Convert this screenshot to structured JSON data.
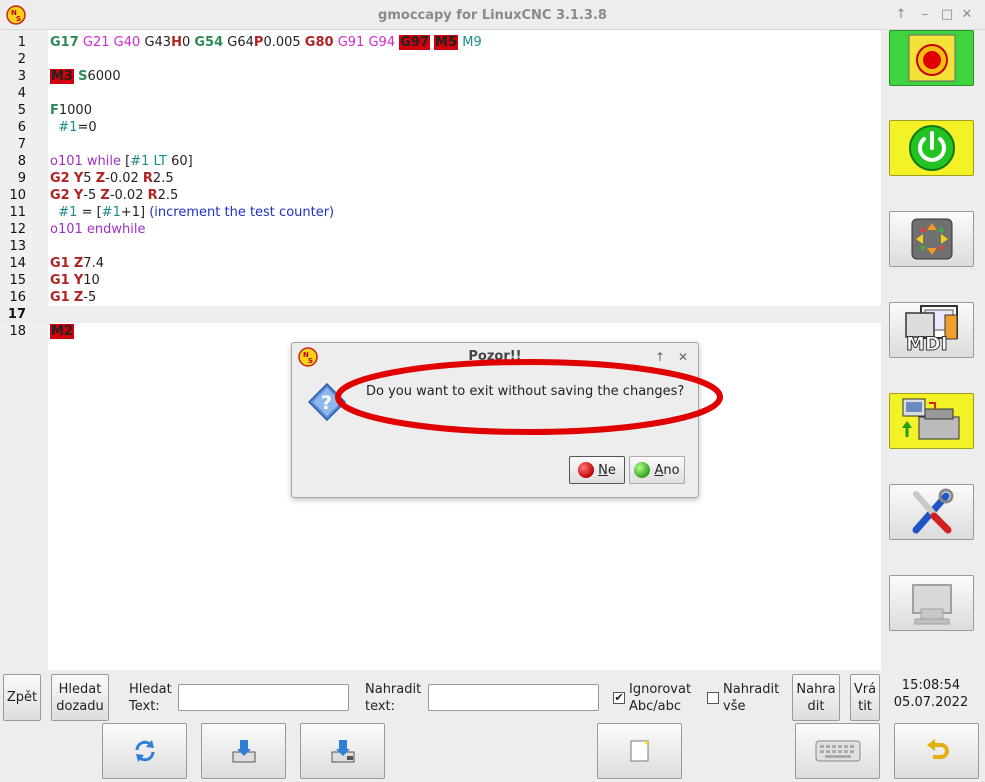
{
  "window": {
    "title": "gmoccapy for LinuxCNC  3.1.3.8",
    "controls": [
      "↑",
      "–",
      "□",
      "✕"
    ]
  },
  "editor": {
    "current_line": 17,
    "lines": [
      {
        "n": "1",
        "tokens": [
          {
            "t": "G17",
            "c": "g"
          },
          {
            "t": " "
          },
          {
            "t": "G21",
            "c": "mod"
          },
          {
            "t": " "
          },
          {
            "t": "G40",
            "c": "mod"
          },
          {
            "t": " "
          },
          {
            "t": "G43",
            "c": "plain"
          },
          {
            "t": "H",
            "c": "letter"
          },
          {
            "t": "0",
            "c": "plain"
          },
          {
            "t": " "
          },
          {
            "t": "G54",
            "c": "g"
          },
          {
            "t": " "
          },
          {
            "t": "G64",
            "c": "plain"
          },
          {
            "t": "P",
            "c": "letter"
          },
          {
            "t": "0.005",
            "c": "plain"
          },
          {
            "t": " "
          },
          {
            "t": "G80",
            "c": "red"
          },
          {
            "t": " "
          },
          {
            "t": "G91",
            "c": "mod"
          },
          {
            "t": " "
          },
          {
            "t": "G94",
            "c": "mod"
          },
          {
            "t": " "
          },
          {
            "t": "G97",
            "c": "hl"
          },
          {
            "t": " "
          },
          {
            "t": "M5",
            "c": "hl"
          },
          {
            "t": " "
          },
          {
            "t": "M9",
            "c": "m9"
          }
        ]
      },
      {
        "n": "2",
        "tokens": []
      },
      {
        "n": "3",
        "tokens": [
          {
            "t": "M3",
            "c": "hl"
          },
          {
            "t": " "
          },
          {
            "t": "S",
            "c": "g"
          },
          {
            "t": "6000",
            "c": "plain"
          }
        ]
      },
      {
        "n": "4",
        "tokens": []
      },
      {
        "n": "5",
        "tokens": [
          {
            "t": "F",
            "c": "g"
          },
          {
            "t": "1000",
            "c": "plain"
          }
        ]
      },
      {
        "n": "6",
        "tokens": [
          {
            "t": "  "
          },
          {
            "t": "#1",
            "c": "var"
          },
          {
            "t": "=0",
            "c": "plain"
          }
        ]
      },
      {
        "n": "7",
        "tokens": []
      },
      {
        "n": "8",
        "tokens": [
          {
            "t": "o101 while",
            "c": "kw"
          },
          {
            "t": " [",
            "c": "plain"
          },
          {
            "t": "#1",
            "c": "var"
          },
          {
            "t": " "
          },
          {
            "t": "LT",
            "c": "var"
          },
          {
            "t": " 60]",
            "c": "plain"
          }
        ]
      },
      {
        "n": "9",
        "tokens": [
          {
            "t": "G2",
            "c": "red"
          },
          {
            "t": " "
          },
          {
            "t": "Y",
            "c": "letter"
          },
          {
            "t": "5 ",
            "c": "plain"
          },
          {
            "t": "Z",
            "c": "letter"
          },
          {
            "t": "-0.02 ",
            "c": "plain"
          },
          {
            "t": "R",
            "c": "letter"
          },
          {
            "t": "2.5",
            "c": "plain"
          }
        ]
      },
      {
        "n": "10",
        "tokens": [
          {
            "t": "G2",
            "c": "red"
          },
          {
            "t": " "
          },
          {
            "t": "Y",
            "c": "letter"
          },
          {
            "t": "-5 ",
            "c": "plain"
          },
          {
            "t": "Z",
            "c": "letter"
          },
          {
            "t": "-0.02 ",
            "c": "plain"
          },
          {
            "t": "R",
            "c": "letter"
          },
          {
            "t": "2.5",
            "c": "plain"
          }
        ]
      },
      {
        "n": "11",
        "tokens": [
          {
            "t": "  "
          },
          {
            "t": "#1",
            "c": "var"
          },
          {
            "t": " = [",
            "c": "plain"
          },
          {
            "t": "#1",
            "c": "var"
          },
          {
            "t": "+1] ",
            "c": "plain"
          },
          {
            "t": "(increment the test counter)",
            "c": "comment"
          }
        ]
      },
      {
        "n": "12",
        "tokens": [
          {
            "t": "o101 endwhile",
            "c": "kw"
          }
        ]
      },
      {
        "n": "13",
        "tokens": []
      },
      {
        "n": "14",
        "tokens": [
          {
            "t": "G1",
            "c": "red"
          },
          {
            "t": " "
          },
          {
            "t": "Z",
            "c": "letter"
          },
          {
            "t": "7.4",
            "c": "plain"
          }
        ]
      },
      {
        "n": "15",
        "tokens": [
          {
            "t": "G1",
            "c": "red"
          },
          {
            "t": " "
          },
          {
            "t": "Y",
            "c": "letter"
          },
          {
            "t": "10",
            "c": "plain"
          }
        ]
      },
      {
        "n": "16",
        "tokens": [
          {
            "t": "G1",
            "c": "red"
          },
          {
            "t": " "
          },
          {
            "t": "Z",
            "c": "letter"
          },
          {
            "t": "-5",
            "c": "plain"
          }
        ]
      },
      {
        "n": "17",
        "tokens": []
      },
      {
        "n": "18",
        "tokens": [
          {
            "t": "M2",
            "c": "hl"
          }
        ]
      }
    ]
  },
  "side_buttons": [
    {
      "name": "emergency-stop-button",
      "icon": "emergency-stop-icon",
      "color": "#3fd43f"
    },
    {
      "name": "machine-power-button",
      "icon": "power-icon",
      "color": "#f2f226"
    },
    {
      "name": "manual-mode-button",
      "icon": "jog-arrows-icon"
    },
    {
      "name": "mdi-button",
      "icon": "mdi-icon",
      "label": "MDI"
    },
    {
      "name": "auto-mode-button",
      "icon": "auto-machine-icon",
      "color": "#f2f226"
    },
    {
      "name": "settings-button",
      "icon": "tools-icon"
    },
    {
      "name": "user-tabs-button",
      "icon": "user-tabs-icon"
    }
  ],
  "dialog": {
    "title": "Pozor!!",
    "message": "Do you want to exit without saving the changes?",
    "controls": [
      "↑",
      "✕"
    ],
    "no_button": {
      "mnemonic": "N",
      "rest": "e"
    },
    "yes_button": {
      "mnemonic": "A",
      "rest": "no"
    }
  },
  "search_bar": {
    "back_label": "Zpět",
    "search_back_label": [
      "Hledat",
      "dozadu"
    ],
    "search_text_label": [
      "Hledat",
      "Text:"
    ],
    "search_value": "",
    "replace_text_label": [
      "Nahradit",
      "text:"
    ],
    "replace_value": "",
    "ignore_case_label": [
      "Ignorovat",
      "Abc/abc"
    ],
    "ignore_case_checked": true,
    "replace_all_label": [
      "Nahradit",
      "vše"
    ],
    "replace_all_checked": false,
    "replace_button_label": [
      "Nahra",
      "dit"
    ],
    "undo_button_label": [
      "Vrá",
      "tit"
    ]
  },
  "clock": {
    "time": "15:08:54",
    "date": "05.07.2022"
  },
  "bottom_buttons": [
    {
      "name": "reload-button",
      "icon": "reload-icon"
    },
    {
      "name": "save-button",
      "icon": "save-icon"
    },
    {
      "name": "save-as-button",
      "icon": "save-as-icon"
    },
    {
      "name": "new-file-button",
      "icon": "new-document-icon"
    },
    {
      "name": "keyboard-button",
      "icon": "keyboard-icon"
    },
    {
      "name": "back-button",
      "icon": "return-arrow-icon"
    }
  ]
}
